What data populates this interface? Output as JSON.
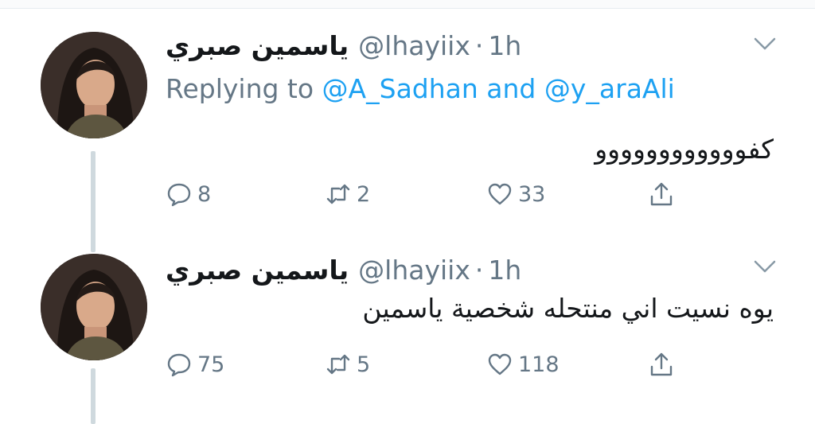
{
  "tweets": [
    {
      "display_name": "ياسمين صبري",
      "handle": "@lhayiix",
      "separator": "·",
      "time": "1h",
      "replying_prefix": "Replying to",
      "replying_user1": "@A_Sadhan",
      "replying_and": "and",
      "replying_user2": "@y_araAli",
      "text": "كفوووووووووووو",
      "replies": "8",
      "retweets": "2",
      "likes": "33"
    },
    {
      "display_name": "ياسمين صبري",
      "handle": "@lhayiix",
      "separator": "·",
      "time": "1h",
      "text": "يوه نسيت اني منتحله شخصية ياسمين",
      "replies": "75",
      "retweets": "5",
      "likes": "118"
    }
  ],
  "icons": {
    "reply": "speech-bubble-icon",
    "retweet": "retweet-arrows-icon",
    "like": "heart-icon",
    "share": "share-upload-icon",
    "caret": "chevron-down-icon"
  },
  "colors": {
    "link": "#1da1f2",
    "secondary": "#657786",
    "thread_line": "#cfd9de"
  }
}
